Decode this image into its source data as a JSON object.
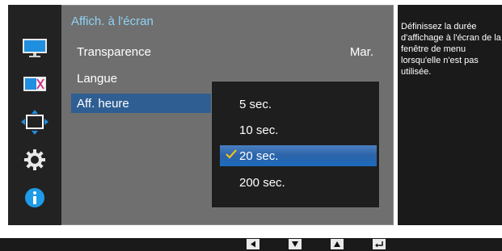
{
  "menu": {
    "title": "Affich. à l'écran",
    "items": [
      {
        "label": "Transparence",
        "value": "Mar."
      },
      {
        "label": "Langue",
        "value": ""
      },
      {
        "label": "Aff. heure",
        "value": ""
      }
    ]
  },
  "dropdown": {
    "options": [
      "5 sec.",
      "10 sec.",
      "20 sec.",
      "200 sec."
    ],
    "selected_index": 2
  },
  "help_text": "Définissez la durée d'affichage à l'écran de la fenêtre de menu lorsqu'elle n'est pas utilisée.",
  "sidebar_icons": [
    "picture-icon",
    "color-icon",
    "size-position-icon",
    "setup-icon",
    "information-icon"
  ],
  "bottom_keys": [
    "left-arrow-key-icon",
    "down-arrow-key-icon",
    "up-arrow-key-icon",
    "enter-key-icon"
  ],
  "colors": {
    "title": "#8fd3f5",
    "highlight": "#2b63a8",
    "check": "#f0c020",
    "info": "#1e9be8"
  }
}
